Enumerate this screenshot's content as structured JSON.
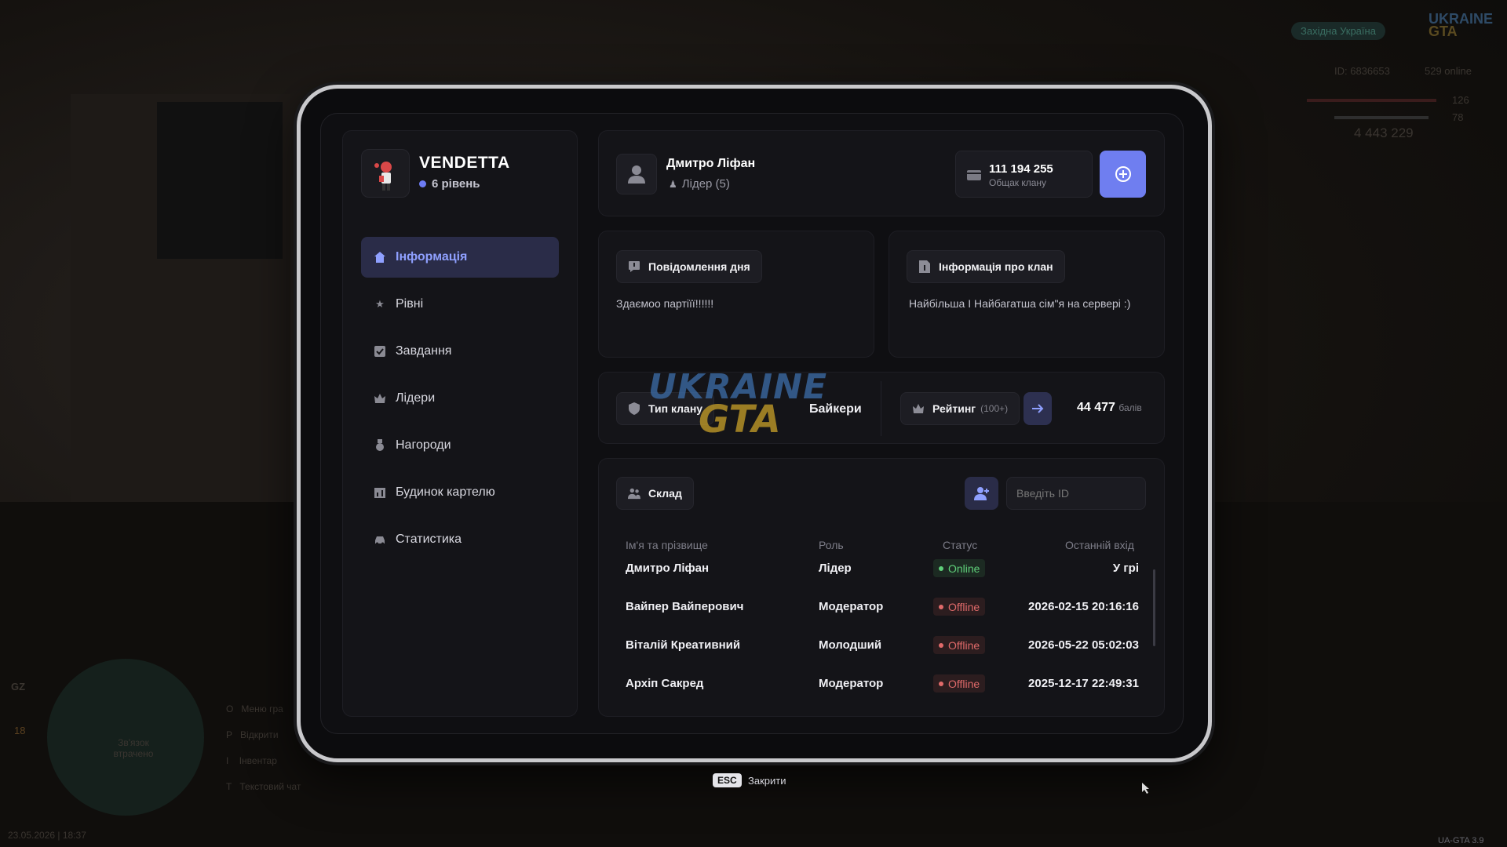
{
  "hud": {
    "server": "Західна Україна",
    "ids": "ID: 6836653",
    "online": "529 online",
    "health": "126",
    "armor": "78",
    "money": "4 443 229",
    "datetime": "23.05.2026 | 18:37",
    "version": "UA-GTA 3.9",
    "zone_short": "GZ",
    "zone_num": "18",
    "binds": [
      "Меню гра",
      "Відкрити",
      "Інвентар",
      "Текстовий чат"
    ],
    "bind_keys": [
      "O",
      "P",
      "I",
      "T"
    ],
    "voice_text": "Зв'язок втрачено"
  },
  "watermark": {
    "line1": "UKRAINE",
    "line2": "GTA"
  },
  "clan": {
    "name": "VENDETTA",
    "level": "6 рівень"
  },
  "nav": [
    {
      "label": "Інформація",
      "icon": "home-icon",
      "active": true
    },
    {
      "label": "Рівні",
      "icon": "star-icon"
    },
    {
      "label": "Завдання",
      "icon": "checkbox-icon"
    },
    {
      "label": "Лідери",
      "icon": "crown-icon"
    },
    {
      "label": "Нагороди",
      "icon": "medal-icon"
    },
    {
      "label": "Будинок картелю",
      "icon": "building-icon"
    },
    {
      "label": "Статистика",
      "icon": "car-icon"
    }
  ],
  "user": {
    "name": "Дмитро Ліфан",
    "role": "Лідер (5)"
  },
  "bank": {
    "value": "111 194 255",
    "label": "Общак клану"
  },
  "motd": {
    "title": "Повідомлення дня",
    "text": "Здаємоо партіїї!!!!!!"
  },
  "info": {
    "title": "Інформація про клан",
    "text": "Найбільша І Найбагатша сім\"я на сервері :)"
  },
  "clan_type": {
    "label": "Тип клану",
    "value": "Байкери"
  },
  "rating": {
    "label": "Рейтинг",
    "sub": "(100+)",
    "value": "44 477",
    "unit": "балів"
  },
  "roster": {
    "title": "Склад",
    "search_placeholder": "Введіть ID",
    "headers": [
      "Ім'я та прізвище",
      "Роль",
      "Статус",
      "Останній вхід"
    ],
    "rows": [
      {
        "name": "Дмитро Ліфан",
        "role": "Лідер",
        "status": "Online",
        "last": "У грі"
      },
      {
        "name": "Вайпер Вайперович",
        "role": "Модератор",
        "status": "Offline",
        "last": "2026-02-15 20:16:16"
      },
      {
        "name": "Віталій Креативний",
        "role": "Молодший",
        "status": "Offline",
        "last": "2026-05-22 05:02:03"
      },
      {
        "name": "Архіп Сакред",
        "role": "Модератор",
        "status": "Offline",
        "last": "2025-12-17 22:49:31"
      }
    ]
  },
  "footer": {
    "key": "ESC",
    "label": "Закрити"
  },
  "colors": {
    "accent": "#6f7ef0",
    "online": "#5fd07a",
    "offline": "#e06a6a",
    "nav_active_bg": "#2a2c48"
  }
}
